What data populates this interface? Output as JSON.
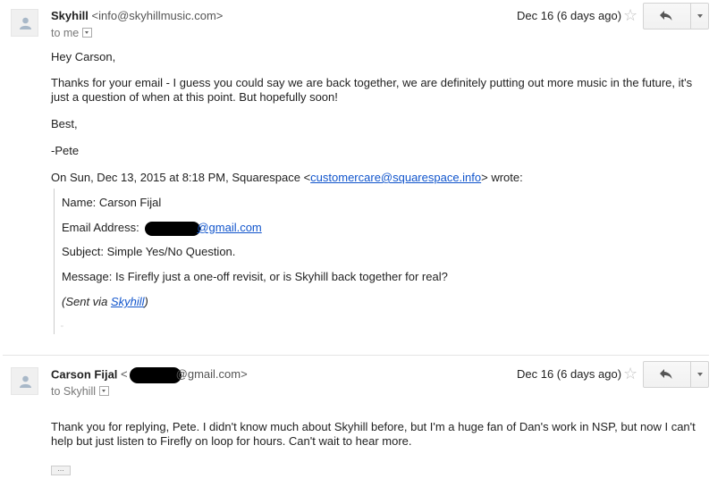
{
  "messages": [
    {
      "sender_name": "Skyhill",
      "sender_email": "<info@skyhillmusic.com>",
      "recipient": "to me",
      "date": "Dec 16 (6 days ago)",
      "greeting": "Hey Carson,",
      "body_line1": "Thanks for your email - I guess you could say we are back together, we are definitely putting out more music in the future, it's",
      "body_line2": "just a question of when at this point.  But hopefully soon!",
      "closing": "Best,",
      "signature": "-Pete",
      "quote_intro_prefix": "On Sun, Dec 13, 2015 at 8:18 PM, Squarespace <",
      "quote_intro_link": "customercare@squarespace.info",
      "quote_intro_suffix": "> wrote:",
      "quoted": {
        "name": "Name: Carson Fijal",
        "email_label": "Email Address: ",
        "email_domain": "@gmail.com",
        "subject": "Subject: Simple Yes/No Question.",
        "message": "Message: Is Firefly just a one-off revisit, or is Skyhill back together for real?",
        "sent_prefix": "(Sent via ",
        "sent_link": "Skyhill",
        "sent_suffix": ")"
      }
    },
    {
      "sender_name": "Carson Fijal",
      "sender_email_prefix": "<",
      "sender_email_domain": "@gmail.com>",
      "recipient": "to Skyhill",
      "date": "Dec 16 (6 days ago)",
      "body_line1": "Thank you for replying, Pete. I didn't know much about Skyhill before, but I'm a huge fan of Dan's work in NSP, but now I can't",
      "body_line2": "help but just listen to Firefly on loop for hours. Can't wait to hear more.",
      "ellipsis": "..."
    }
  ],
  "icons": {
    "star": "☆",
    "reply": "reply-arrow-icon",
    "more": "chevron-down-icon"
  }
}
